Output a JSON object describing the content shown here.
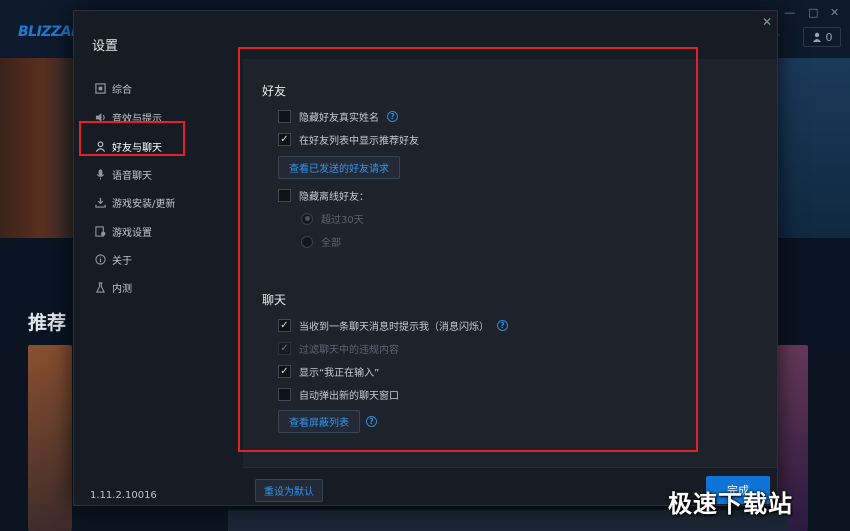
{
  "background": {
    "logo": "BLIZZARD",
    "window_controls": [
      "—",
      "□",
      "✕"
    ],
    "lang_menu": "⌵",
    "friends_count": "0",
    "section_title": "推荐"
  },
  "dialog": {
    "title": "设置",
    "close_label": "✕",
    "sidebar": {
      "items": [
        {
          "label": "综合",
          "icon": "general-icon"
        },
        {
          "label": "音效与提示",
          "icon": "sound-icon"
        },
        {
          "label": "好友与聊天",
          "icon": "friends-icon"
        },
        {
          "label": "语音聊天",
          "icon": "microphone-icon"
        },
        {
          "label": "游戏安装/更新",
          "icon": "download-icon"
        },
        {
          "label": "游戏设置",
          "icon": "game-settings-icon"
        },
        {
          "label": "关于",
          "icon": "info-icon"
        },
        {
          "label": "内测",
          "icon": "flask-icon"
        }
      ],
      "active_index": 2,
      "version": "1.11.2.10016"
    },
    "friends": {
      "title": "好友",
      "hide_real_name": {
        "label": "隐藏好友真实姓名",
        "checked": false
      },
      "show_recommended": {
        "label": "在好友列表中显示推荐好友",
        "checked": true
      },
      "view_sent_requests": "查看已发送的好友请求",
      "hide_offline": {
        "label": "隐藏离线好友：",
        "checked": false
      },
      "offline_options": [
        {
          "label": "超过30天",
          "selected": true
        },
        {
          "label": "全部",
          "selected": false
        }
      ]
    },
    "chat": {
      "title": "聊天",
      "notify_new_message": {
        "label": "当收到一条聊天消息时提示我（消息闪烁）",
        "checked": true
      },
      "filter_profanity": {
        "label": "过滤聊天中的违规内容",
        "checked": true,
        "disabled": true
      },
      "show_typing": {
        "label": "显示“我正在输入”",
        "checked": true
      },
      "auto_popup": {
        "label": "自动弹出新的聊天窗口",
        "checked": false
      },
      "view_blocked": "查看屏蔽列表"
    },
    "footer": {
      "reset_label": "重设为默认",
      "done_label": "完成"
    }
  },
  "watermark": "极速下载站",
  "colors": {
    "accent": "#0e74d8",
    "link": "#2f95f0",
    "annotation": "#e0232b",
    "dialog_bg": "#171b23",
    "content_bg": "#1d222b"
  }
}
